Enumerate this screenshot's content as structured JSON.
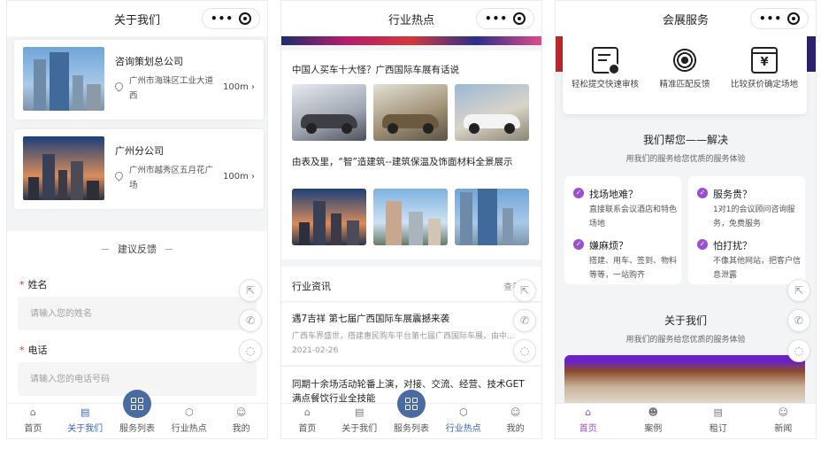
{
  "phone1": {
    "title": "关于我们",
    "companies": [
      {
        "name": "咨询策划总公司",
        "address": "广州市海珠区工业大道西",
        "distance": "100m"
      },
      {
        "name": "广州分公司",
        "address": "广州市越秀区五月花广场",
        "distance": "100m"
      }
    ],
    "feedback_title": "建议反馈",
    "form": {
      "name_label": "姓名",
      "name_placeholder": "请输入您的姓名",
      "phone_label": "电话",
      "phone_placeholder": "请输入您的电话号码"
    },
    "tabs": [
      "首页",
      "关于我们",
      "服务列表",
      "行业热点",
      "我的"
    ],
    "active_tab": "关于我们"
  },
  "phone2": {
    "title": "行业热点",
    "news": [
      {
        "title": "中国人买车十大怪？广西国际车展有话说"
      },
      {
        "title": "由表及里，“智”造建筑--建筑保温及饰面材料全景展示"
      }
    ],
    "section_title": "行业资讯",
    "section_more": "查看全",
    "articles": [
      {
        "title": "遇7吉祥 第七届广西国际车展震撼来袭",
        "summary": "广西车界盛世，搭建惠民购车平台第七届广西国际车展，由中...",
        "date": "2021-02-26"
      },
      {
        "title": "同期十余场活动轮番上演，对接、交流、经营、技术GET满点餐饮行业全技能"
      }
    ],
    "tabs": [
      "首页",
      "关于我们",
      "服务列表",
      "行业热点",
      "我的"
    ],
    "active_tab": "行业热点"
  },
  "phone3": {
    "title": "会展服务",
    "services": [
      {
        "label": "轻松提交快速审核",
        "icon": "form-icon"
      },
      {
        "label": "精准匹配反馈",
        "icon": "target-icon"
      },
      {
        "label": "比较获价确定场地",
        "icon": "price-icon"
      }
    ],
    "help_title": "我们帮您——解决",
    "help_sub": "用我们的服务给您优质的服务体验",
    "benefits": [
      {
        "q": "找场地难？",
        "a": "直接联系会议酒店和特色场地"
      },
      {
        "q": "服务贵？",
        "a": "1对1的会议顾问咨询服务，免费服务"
      },
      {
        "q": "嫌麻烦？",
        "a": "搭建、用车、签到、物料等等，一站购齐"
      },
      {
        "q": "怕打扰？",
        "a": "不像其他网站，把客户信息泄露"
      }
    ],
    "about_title": "关于我们",
    "about_sub": "用我们的服务给您优质的服务体验",
    "tabs": [
      "首页",
      "案例",
      "租订",
      "新闻"
    ],
    "active_tab": "首页"
  },
  "colors": {
    "accent_blue": "#3a64c8",
    "accent_purple": "#9c4fd2",
    "required_star": "#e03030"
  }
}
